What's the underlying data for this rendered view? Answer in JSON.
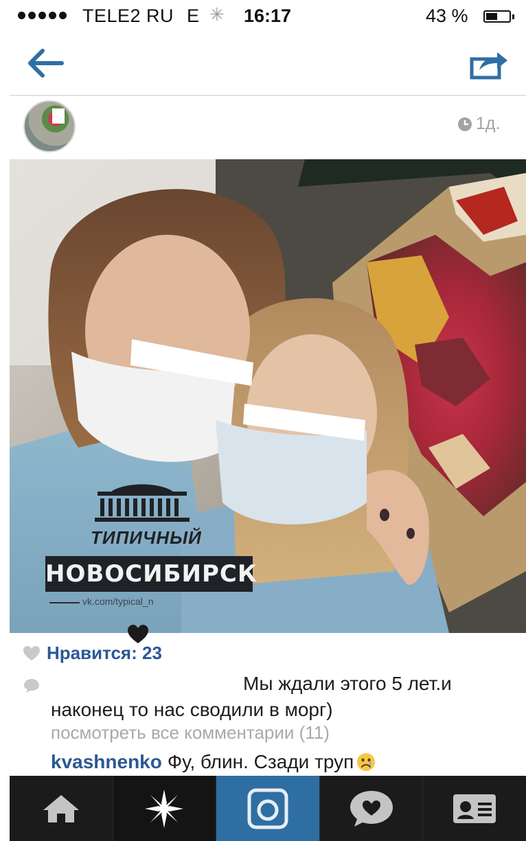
{
  "status_bar": {
    "carrier": "TELE2 RU",
    "network": "E",
    "time": "16:17",
    "battery_percent": "43 %",
    "battery_level": 0.43,
    "signal_bars": 5
  },
  "nav": {
    "back_icon": "arrow-left-icon",
    "share_icon": "share-icon",
    "accent_color": "#2f6ea3"
  },
  "post": {
    "timestamp": "1д.",
    "watermark": {
      "line1": "типичный",
      "line2": "НОВОСИБИРСК",
      "url": "vk.com/typical_n"
    },
    "likes_label": "Нравится: 23",
    "caption_line1": "Мы ждали этого 5 лет.и",
    "caption_line2": "наконец то нас сводили в морг)",
    "view_all_comments": "посмотреть все комментарии (11)",
    "comment": {
      "user": "kvashnenko",
      "text": "Фу, блин. Сзади труп"
    }
  },
  "tab_bar": {
    "tabs": [
      {
        "icon": "home-icon",
        "active": false
      },
      {
        "icon": "explore-icon",
        "active": false
      },
      {
        "icon": "camera-icon",
        "active": true
      },
      {
        "icon": "activity-icon",
        "active": false
      },
      {
        "icon": "profile-icon",
        "active": false
      }
    ]
  },
  "colors": {
    "link_blue": "#2a5896",
    "tab_bar_bg": "#1b1b1b",
    "tab_active": "#2f6ea3"
  }
}
